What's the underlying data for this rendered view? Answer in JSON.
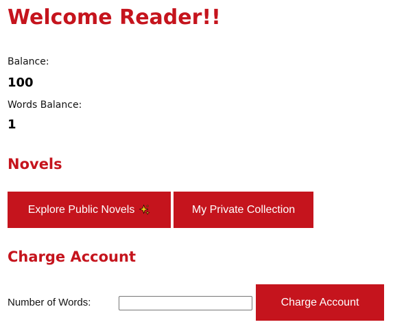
{
  "header": {
    "title": "Welcome Reader!!"
  },
  "account": {
    "balance_label": "Balance:",
    "balance_value": "100",
    "words_balance_label": "Words Balance:",
    "words_balance_value": "1"
  },
  "novels": {
    "heading": "Novels",
    "explore_label": "Explore Public Novels",
    "explore_icon": "sparkle-icon",
    "private_label": "My Private Collection"
  },
  "charge": {
    "heading": "Charge Account",
    "words_label": "Number of Words:",
    "words_value": "",
    "words_placeholder": "",
    "submit_label": "Charge Account"
  },
  "colors": {
    "accent": "#c5141d",
    "button_text": "#ffffff",
    "sparkle": "#f5c518"
  }
}
